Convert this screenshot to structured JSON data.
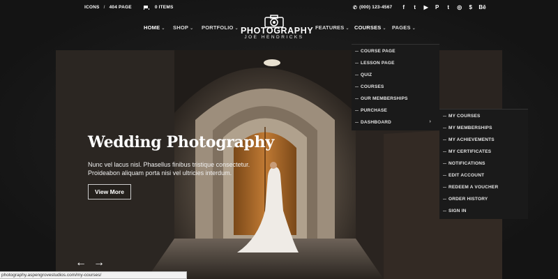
{
  "topbar": {
    "icons_label": "ICONS",
    "separator": "/",
    "page_404_label": "404 PAGE",
    "cart_label": "0 ITEMS",
    "phone": "(000) 123-4567",
    "social": [
      "f",
      "t",
      "▶",
      "P",
      "t",
      "◎",
      "$",
      "Bē"
    ]
  },
  "nav": {
    "home": "HOME",
    "shop": "SHOP",
    "portfolio": "PORTFOLIO",
    "features": "FEATURES",
    "courses": "COURSES",
    "pages": "PAGES"
  },
  "logo": {
    "title": "PHOTOGRAPHY",
    "subtitle": "JOE HENDRICKS"
  },
  "courses_menu": [
    "COURSE PAGE",
    "LESSON PAGE",
    "QUIZ",
    "COURSES",
    "OUR MEMBERSHIPS",
    "PURCHASE",
    "DASHBOARD"
  ],
  "dashboard_menu": [
    "MY COURSES",
    "MY MEMBERSHIPS",
    "MY ACHIEVEMENTS",
    "MY CERTIFICATES",
    "NOTIFICATIONS",
    "EDIT ACCOUNT",
    "REDEEM A VOUCHER",
    "ORDER HISTORY",
    "SIGN IN"
  ],
  "hero": {
    "title": "Wedding Photography",
    "line1": "Nunc vel lacus nisl. Phasellus finibus tristique consectetur.",
    "line2": "Proideabon aliquam porta nisi vel ultricies interdum.",
    "button": "View More",
    "prev": "←",
    "next": "→"
  },
  "statusbar": {
    "url": "photography.aspengrovestudios.com/my-courses/"
  },
  "colors": {
    "background": "#1c1c1c",
    "dropdown": "#1a1a1a",
    "door": "#b8732e"
  }
}
